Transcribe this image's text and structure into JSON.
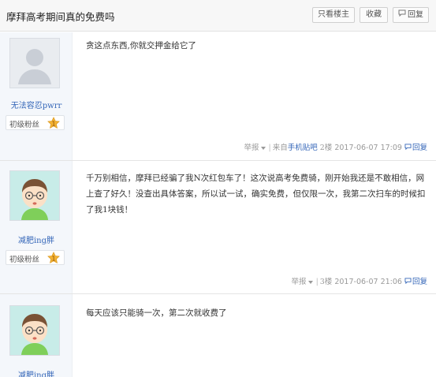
{
  "header": {
    "title": "摩拜高考期间真的免费吗",
    "buttons": {
      "only_op": "只看楼主",
      "collect": "收藏",
      "reply": "回复"
    }
  },
  "posts": [
    {
      "username": "无法容忍pwrr",
      "level": "初级粉丝",
      "level_num": "1",
      "content": "贪这点东西,你就交押金给它了",
      "report": "举报",
      "source_prefix": "来自",
      "source": "手机贴吧",
      "floor": "2楼",
      "time": "2017-06-07 17:09",
      "reply": "回复",
      "avatar": "default-avatar"
    },
    {
      "username": "减肥ing胖",
      "level": "初级粉丝",
      "level_num": "1",
      "content": "千万别相信，摩拜已经骗了我N次红包车了！这次说高考免费骑，刚开始我还是不敢相信，网上查了好久！没查出具体答案，所以试一试，确实免费，但仅限一次，我第二次扫车的时候扣了我1块钱！",
      "report": "举报",
      "floor": "3楼",
      "time": "2017-06-07 21:06",
      "reply": "回复",
      "avatar": "cartoon-boy-avatar"
    },
    {
      "username": "减肥ing胖",
      "content": "每天应该只能骑一次，第二次就收费了",
      "avatar": "cartoon-boy-avatar"
    }
  ],
  "colors": {
    "link": "#3466b8",
    "badge": "#f2b233",
    "sidebar": "#f4f7fb"
  }
}
